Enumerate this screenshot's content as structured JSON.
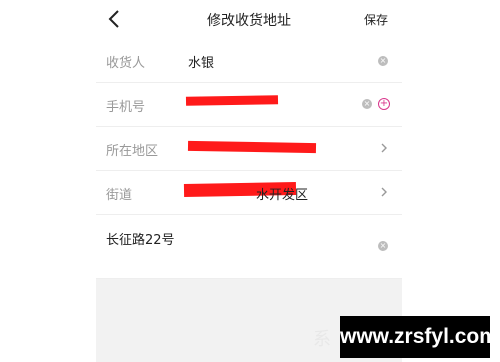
{
  "header": {
    "title": "修改收货地址",
    "save_label": "保存"
  },
  "form": {
    "rows": [
      {
        "label": "收货人",
        "value": "水银"
      },
      {
        "label": "手机号",
        "value": ""
      },
      {
        "label": "所在地区",
        "value": ""
      },
      {
        "label": "街道",
        "value": "水开发区"
      }
    ],
    "detail_address": "长征路22号"
  },
  "icons": {
    "back": "chevron-left-icon",
    "clear": "clear-circle-icon",
    "add_contact": "plus-circle-icon",
    "chevron": "chevron-right-icon"
  },
  "colors": {
    "redaction": "#ff1a1a",
    "accent": "#d9358c",
    "label": "#999999"
  },
  "watermark": {
    "text": "www.zrsfyl.com",
    "logo_text": "系"
  }
}
